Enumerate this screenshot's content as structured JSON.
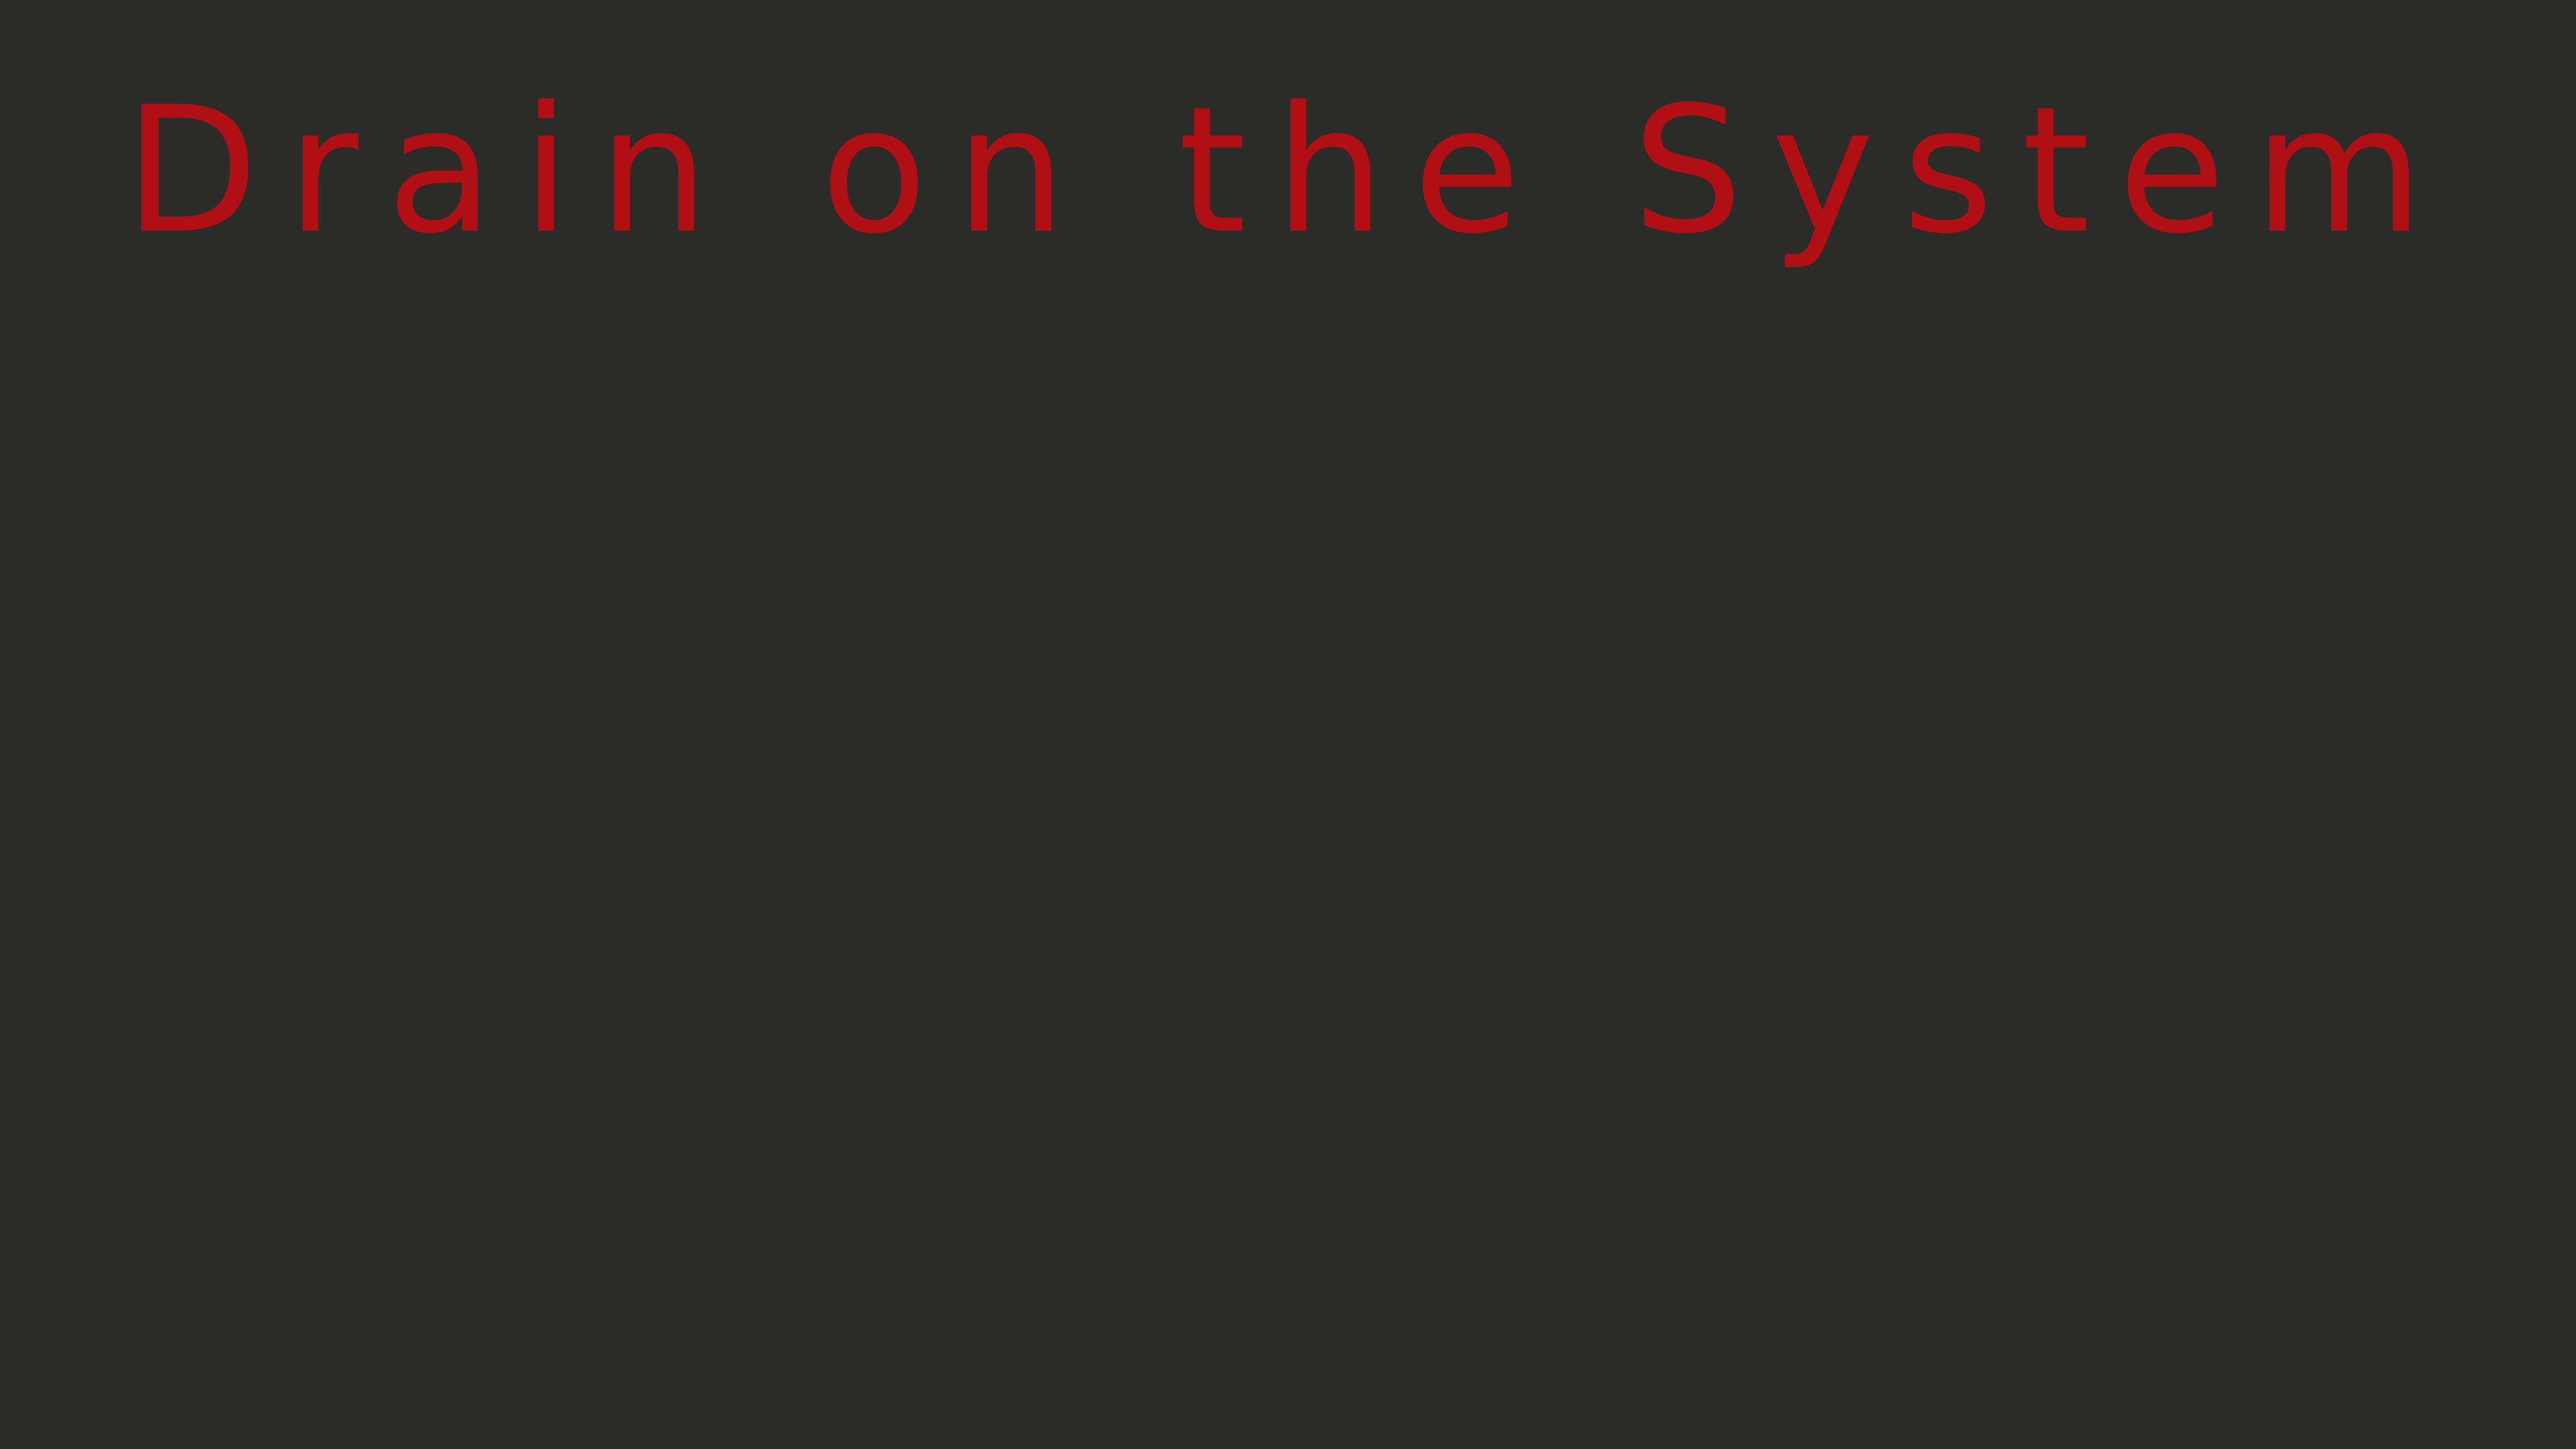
{
  "title": {
    "text": "Drain on the System",
    "color": "#b00f14"
  },
  "background_color": "#2b2b29"
}
